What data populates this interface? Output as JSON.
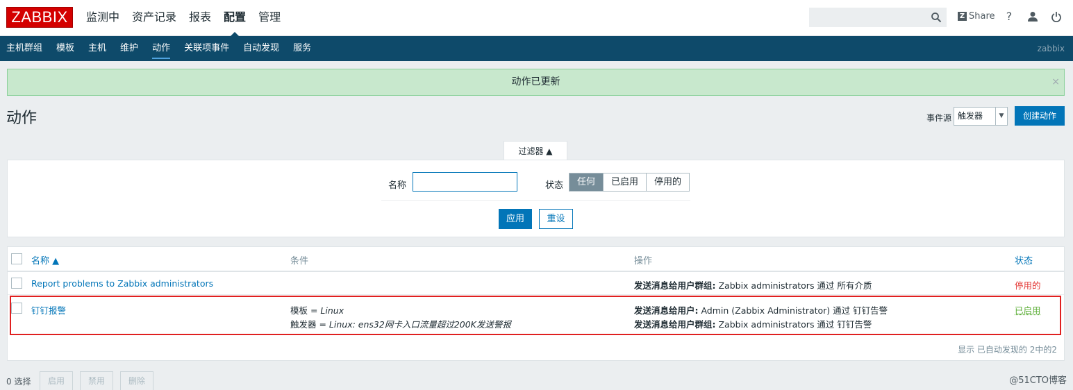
{
  "header": {
    "logo": "ZABBIX",
    "nav": [
      "监测中",
      "资产记录",
      "报表",
      "配置",
      "管理"
    ],
    "active_nav": "配置",
    "share": "Share",
    "help": "?"
  },
  "subnav": {
    "items": [
      "主机群组",
      "模板",
      "主机",
      "维护",
      "动作",
      "关联项事件",
      "自动发现",
      "服务"
    ],
    "active": "动作",
    "user": "zabbix"
  },
  "message": {
    "text": "动作已更新",
    "close": "×"
  },
  "page": {
    "title": "动作",
    "event_source_label": "事件源",
    "event_source_value": "触发器",
    "create_button": "创建动作"
  },
  "filter": {
    "tab": "过滤器 ▲",
    "name_label": "名称",
    "name_value": "",
    "status_label": "状态",
    "status_options": [
      "任何",
      "已启用",
      "停用的"
    ],
    "status_selected": "任何",
    "apply": "应用",
    "reset": "重设"
  },
  "table": {
    "headers": {
      "name": "名称 ▲",
      "conditions": "条件",
      "operations": "操作",
      "status": "状态"
    },
    "rows": [
      {
        "name": "Report problems to Zabbix administrators",
        "conditions": [],
        "operations": [
          {
            "label": "发送消息给用户群组:",
            "text": " Zabbix administrators 通过 所有介质"
          }
        ],
        "status": "停用的"
      },
      {
        "name": "钉钉报警",
        "conditions": [
          {
            "label": "模板 = ",
            "value": "Linux"
          },
          {
            "label": "触发器 = ",
            "value": "Linux: ens32网卡入口流量超过200K发送警报"
          }
        ],
        "operations": [
          {
            "label": "发送消息给用户:",
            "text": " Admin (Zabbix Administrator) 通过 钉钉告警"
          },
          {
            "label": "发送消息给用户群组:",
            "text": " Zabbix administrators 通过 钉钉告警"
          }
        ],
        "status": "已启用"
      }
    ],
    "footer": "显示 已自动发现的 2中的2"
  },
  "bottom": {
    "selected": "0 选择",
    "buttons": [
      "启用",
      "禁用",
      "删除"
    ]
  },
  "watermark": "@51CTO博客",
  "colors": {
    "brand": "#d40000",
    "nav_bg": "#0e4a6a",
    "accent": "#0275b8",
    "success_bg": "#c8e8cd",
    "disabled": "#e33734",
    "enabled": "#59ad33"
  }
}
